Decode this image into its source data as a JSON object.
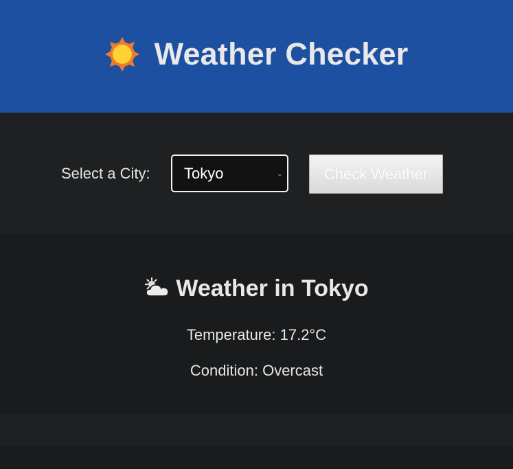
{
  "header": {
    "title": "Weather Checker",
    "icon": "sun-icon",
    "background": "#1e50a2"
  },
  "controls": {
    "label": "Select a City:",
    "selected_city": "Tokyo",
    "button_label": "Check Weather"
  },
  "result": {
    "title_prefix": "Weather in",
    "city": "Tokyo",
    "icon": "sun-behind-cloud-icon",
    "temperature_label": "Temperature:",
    "temperature_value": "17.2°C",
    "condition_label": "Condition:",
    "condition_value": "Overcast"
  }
}
